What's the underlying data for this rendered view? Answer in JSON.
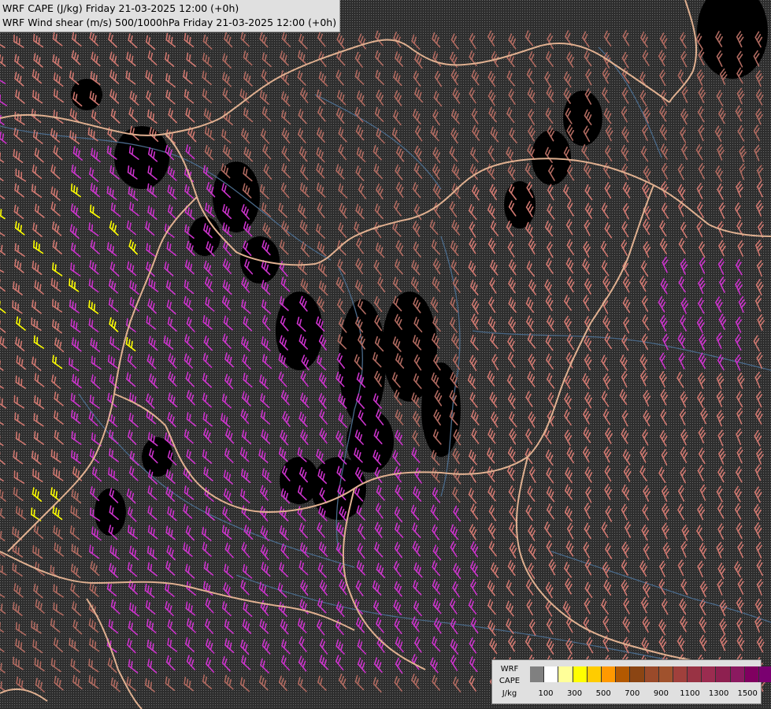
{
  "titles": {
    "line1": "WRF CAPE (J/kg) Friday 21-03-2025 12:00 (+0h)",
    "line2": "WRF Wind shear (m/s) 500/1000hPa Friday 21-03-2025 12:00 (+0h)"
  },
  "legend": {
    "label_line1": "WRF",
    "label_line2": "CAPE",
    "label_line3": "J/kg",
    "swatches": [
      "#808080",
      "#ffffff",
      "#ffff99",
      "#ffff00",
      "#ffcc00",
      "#ff9900",
      "#b35900",
      "#8b4513",
      "#9a4a2a",
      "#a0522d",
      "#a0403c",
      "#993344",
      "#9b2c50",
      "#8e2050",
      "#8b1a60",
      "#800060",
      "#7a0070"
    ],
    "ticks": [
      "100",
      "300",
      "500",
      "700",
      "900",
      "1100",
      "1300",
      "1500"
    ]
  },
  "colors": {
    "background": "#2a2a2a",
    "border_color": "#e0b090",
    "river_color": "#4a6a8a",
    "barb_low": "#b06a60",
    "barb_mid": "#d07870",
    "barb_high": "#cc33cc",
    "barb_very_high": "#ff44ff",
    "barb_cape": "#ffff00"
  }
}
